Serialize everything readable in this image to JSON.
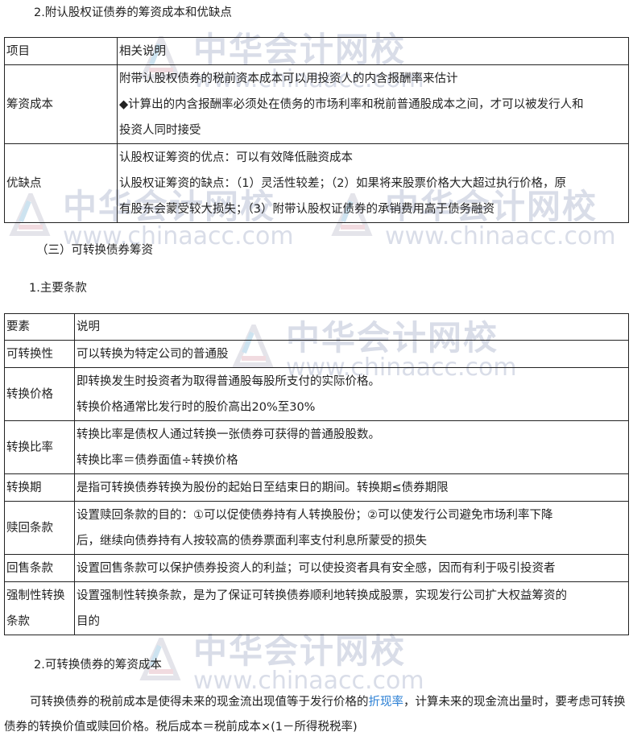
{
  "section1_title": "2.附认股权证债券的筹资成本和优缺点",
  "table1": {
    "headers": [
      "项目",
      "相关说明"
    ],
    "rows": [
      {
        "label": "筹资成本",
        "lines": [
          "附带认股权债券的税前资本成本可以用投资人的内含报酬率来估计",
          "◆计算出的内含报酬率必须处在债务的市场利率和税前普通股成本之间，才可以被发行人和",
          "投资人同时接受"
        ]
      },
      {
        "label": "优缺点",
        "lines": [
          "认股权证筹资的优点：可以有效降低融资成本",
          "认股权证筹资的缺点：（1）灵活性较差；（2）如果将来股票价格大大超过执行价格，原",
          "有股东会蒙受较大损失；（3）附带认股权证债券的承销费用高于债务融资"
        ]
      }
    ]
  },
  "section3_heading": "（三）可转换债券筹资",
  "sub1_heading": "1.主要条款",
  "table2": {
    "headers": [
      "要素",
      "说明"
    ],
    "rows": [
      {
        "label": [
          "可转换性"
        ],
        "lines": [
          "可以转换为特定公司的普通股"
        ]
      },
      {
        "label": [
          "转换价格"
        ],
        "lines": [
          "即转换发生时投资者为取得普通股每股所支付的实际价格。",
          "转换价格通常比发行时的股价高出20%至30%"
        ]
      },
      {
        "label": [
          "转换比率"
        ],
        "lines": [
          "转换比率是债权人通过转换一张债券可获得的普通股股数。",
          "转换比率＝债券面值÷转换价格"
        ]
      },
      {
        "label": [
          "转换期"
        ],
        "lines": [
          "是指可转换债券转换为股份的起始日至结束日的期间。转换期≤债券期限"
        ]
      },
      {
        "label": [
          "赎回条款"
        ],
        "lines": [
          "设置赎回条款的目的：①可以促使债券持有人转换股份；②可以使发行公司避免市场利率下降",
          "后，继续向债券持有人按较高的债券票面利率支付利息所蒙受的损失"
        ]
      },
      {
        "label": [
          "回售条款"
        ],
        "lines": [
          "设置回售条款可以保护债券投资人的利益；可以使投资者具有安全感，因而有利于吸引投资者"
        ]
      },
      {
        "label": [
          "强制性转换",
          "条款"
        ],
        "lines": [
          "设置强制性转换条款，是为了保证可转换债券顺利地转换成股票，实现发行公司扩大权益筹资的",
          "目的"
        ]
      }
    ]
  },
  "sub2_heading": "2.可转换债券的筹资成本",
  "paragraph": {
    "part1": "可转换债券的税前成本是使得未来的现金流出现值等于发行价格的",
    "link": "折现率",
    "part2": "，计算未来的现金流出量时，要考虑可转换债券的转换价值或赎回价格。税后成本＝税前成本×(1－所得税税率)"
  },
  "watermark": {
    "cn": "中华会计网校",
    "url": "www.chinaacc.com"
  },
  "colors": {
    "link": "#2a7fd4",
    "border": "#222222",
    "watermark": "#d9dde8"
  }
}
